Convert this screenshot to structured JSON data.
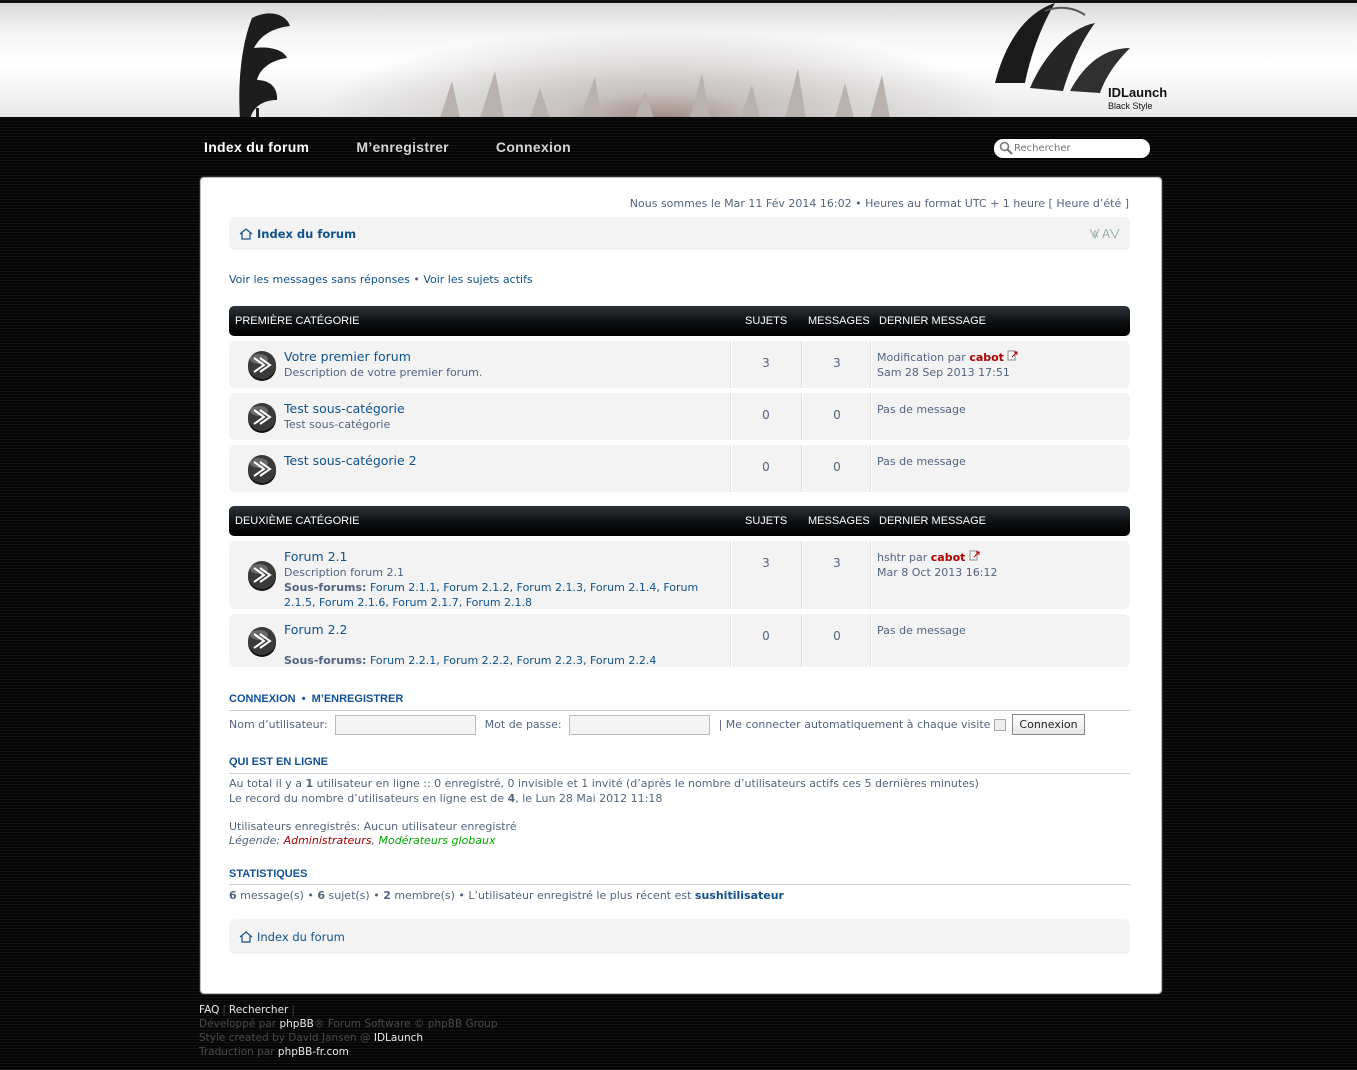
{
  "header": {
    "brand_name": "IDLaunch",
    "brand_tagline": "Black Style"
  },
  "nav": {
    "items": [
      "Index du forum",
      "M’enregistrer",
      "Connexion"
    ],
    "search_placeholder": "Rechercher"
  },
  "datebar": "Nous sommes le Mar 11 Fév 2014 16:02 • Heures au format UTC + 1 heure [ Heure d’été ]",
  "breadcrumb": "Index du forum",
  "quicklinks": {
    "unanswered": "Voir les messages sans réponses",
    "sep": " • ",
    "active": "Voir les sujets actifs"
  },
  "columns": {
    "topics": "SUJETS",
    "posts": "MESSAGES",
    "last": "DERNIER MESSAGE"
  },
  "categories": [
    {
      "title": "PREMIÈRE CATÉGORIE",
      "forums": [
        {
          "title": "Votre premier forum",
          "desc": "Description de votre premier forum.",
          "topics": "3",
          "posts": "3",
          "last_topic": "Modification",
          "by": "par",
          "author": "cabot",
          "date": "Sam 28 Sep 2013 17:51"
        },
        {
          "title": "Test sous-catégorie",
          "desc": "Test sous-catégorie",
          "topics": "0",
          "posts": "0",
          "none": "Pas de message"
        },
        {
          "title": "Test sous-catégorie 2",
          "desc": "",
          "topics": "0",
          "posts": "0",
          "none": "Pas de message"
        }
      ]
    },
    {
      "title": "DEUXIÈME CATÉGORIE",
      "forums": [
        {
          "title": "Forum 2.1",
          "desc": "Description forum 2.1",
          "subforums_label": "Sous-forums:",
          "subforums": "Forum 2.1.1, Forum 2.1.2, Forum 2.1.3, Forum 2.1.4, Forum 2.1.5, Forum 2.1.6, Forum 2.1.7, Forum 2.1.8",
          "topics": "3",
          "posts": "3",
          "last_topic": "hshtr",
          "by": "par",
          "author": "cabot",
          "date": "Mar 8 Oct 2013 16:12"
        },
        {
          "title": "Forum 2.2",
          "desc": "",
          "subforums_label": "Sous-forums:",
          "subforums": "Forum 2.2.1, Forum 2.2.2, Forum 2.2.3, Forum 2.2.4",
          "topics": "0",
          "posts": "0",
          "none": "Pas de message"
        }
      ]
    }
  ],
  "login": {
    "title_login": "CONNEXION",
    "title_sep": "•",
    "title_register": "M’ENREGISTRER",
    "username_label": "Nom d’utilisateur:",
    "password_label": "Mot de passe:",
    "autologin_label": "| Me connecter automatiquement à chaque visite",
    "button": "Connexion"
  },
  "online": {
    "title": "QUI EST EN LIGNE",
    "line1_a": "Au total il y a ",
    "line1_b": "1",
    "line1_c": " utilisateur en ligne :: 0 enregistré, 0 invisible et 1 invité (d’après le nombre d’utilisateurs actifs ces 5 dernières minutes)",
    "line2_a": "Le record du nombre d’utilisateurs en ligne est de ",
    "line2_b": "4",
    "line2_c": ", le Lun 28 Mai 2012 11:18",
    "registered": "Utilisateurs enregistrés: Aucun utilisateur enregistré",
    "legend_label": "Légende: ",
    "legend_admin": "Administrateurs",
    "legend_sep": ", ",
    "legend_mod": "Modérateurs globaux"
  },
  "stats": {
    "title": "STATISTIQUES",
    "messages_n": "6",
    "messages": " message(s) • ",
    "topics_n": "6",
    "topics": " sujet(s) • ",
    "members_n": "2",
    "members": " membre(s) • L’utilisateur enregistré le plus récent est ",
    "newest": "sushitilisateur"
  },
  "breadcrumb_bottom": "Index du forum",
  "footer": {
    "faq": "FAQ",
    "search": "Rechercher",
    "line2_a": "Développé par ",
    "line2_b": "phpBB",
    "line2_c": "® Forum Software © phpBB Group",
    "line3_a": "Style created by David Jansen @ ",
    "line3_b": "IDLaunch",
    "line4_a": "Traduction par ",
    "line4_b": "phpBB-fr.com"
  }
}
